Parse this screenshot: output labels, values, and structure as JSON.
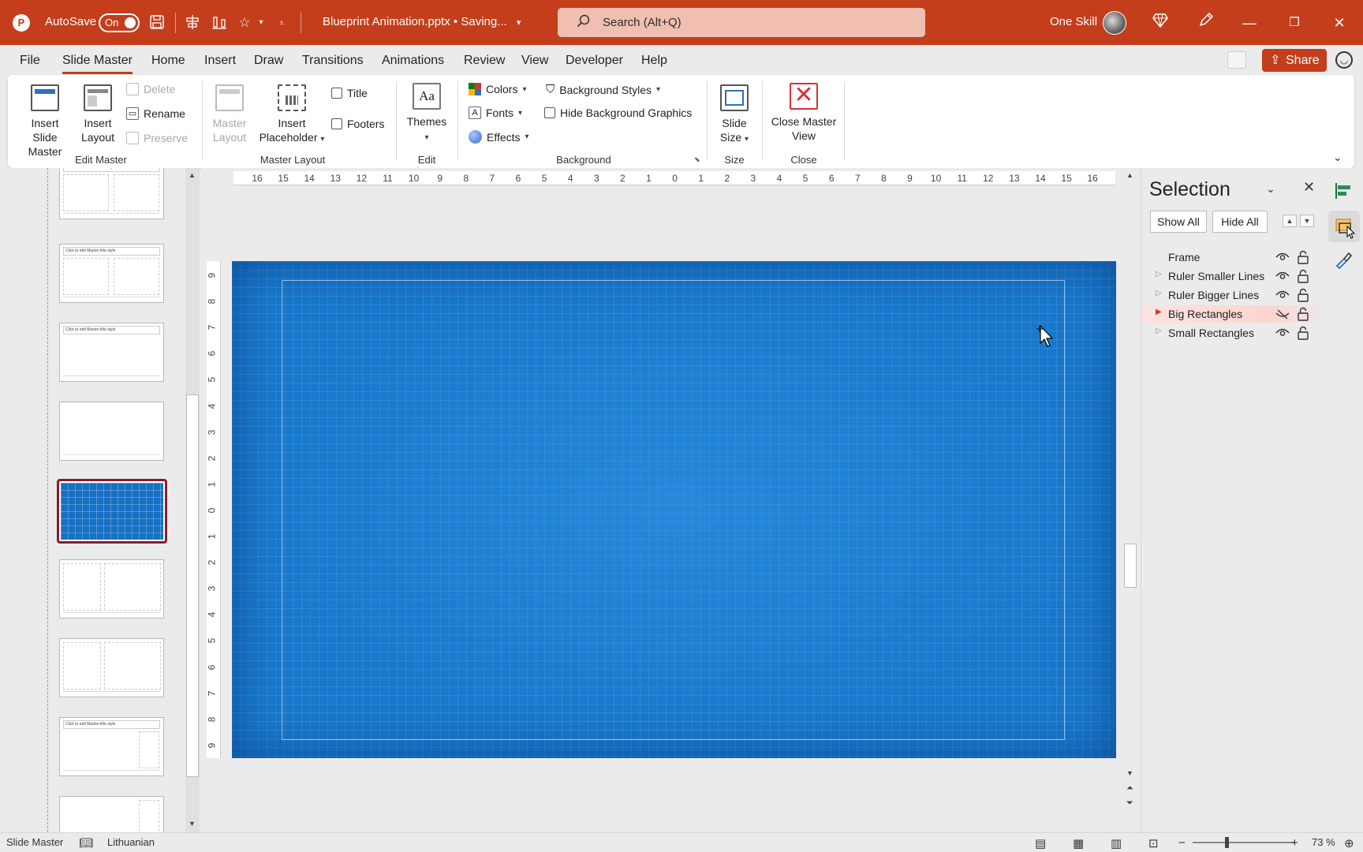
{
  "titlebar": {
    "app_logo": "P",
    "autosave_label": "AutoSave",
    "autosave_state": "On",
    "filename": "Blueprint Animation.pptx • Saving...",
    "search_placeholder": "Search (Alt+Q)",
    "user_name": "One Skill",
    "icons": [
      "powerpoint-logo-icon",
      "save-icon",
      "align-icon",
      "distribute-icon",
      "star-icon",
      "customize-qat-icon",
      "search-icon",
      "premium-diamond-icon",
      "pen-icon",
      "minimize-icon",
      "restore-icon",
      "close-icon"
    ],
    "accent_color": "#c43e1c"
  },
  "menu": {
    "tabs": [
      "File",
      "Slide Master",
      "Home",
      "Insert",
      "Draw",
      "Transitions",
      "Animations",
      "Review",
      "View",
      "Developer",
      "Help"
    ],
    "active_tab": "Slide Master",
    "share_label": "Share"
  },
  "ribbon": {
    "edit_master": {
      "label": "Edit Master",
      "insert_slide_master": "Insert Slide Master",
      "insert_layout": "Insert Layout",
      "delete": "Delete",
      "rename": "Rename",
      "preserve": "Preserve"
    },
    "master_layout": {
      "label": "Master Layout",
      "master_layout_btn": "Master Layout",
      "insert_placeholder": "Insert Placeholder",
      "title_checkbox": "Title",
      "footers_checkbox": "Footers"
    },
    "edit_theme": {
      "label": "Edit Theme",
      "themes": "Themes",
      "themes_icon_text": "Aa"
    },
    "background": {
      "label": "Background",
      "colors": "Colors",
      "fonts": "Fonts",
      "effects": "Effects",
      "background_styles": "Background Styles",
      "hide_background_graphics": "Hide Background Graphics"
    },
    "size": {
      "label": "Size",
      "slide_size": "Slide Size"
    },
    "close": {
      "label": "Close",
      "close_master_view": "Close Master View"
    }
  },
  "thumbnails": {
    "title_placeholder": "Click to edit Master title style",
    "selected_index": 4,
    "selected_color": "#1670c4"
  },
  "rulers": {
    "horizontal": [
      "16",
      "15",
      "14",
      "13",
      "12",
      "11",
      "10",
      "9",
      "8",
      "7",
      "6",
      "5",
      "4",
      "3",
      "2",
      "1",
      "0",
      "1",
      "2",
      "3",
      "4",
      "5",
      "6",
      "7",
      "8",
      "9",
      "10",
      "11",
      "12",
      "13",
      "14",
      "15",
      "16"
    ],
    "vertical": [
      "9",
      "8",
      "7",
      "6",
      "5",
      "4",
      "3",
      "2",
      "1",
      "0",
      "1",
      "2",
      "3",
      "4",
      "5",
      "6",
      "7",
      "8",
      "9"
    ]
  },
  "slide": {
    "background_color": "#1878cc"
  },
  "selection_pane": {
    "title": "Selection",
    "show_all": "Show All",
    "hide_all": "Hide All",
    "items": [
      {
        "name": "Frame",
        "visible": true,
        "expandable": false,
        "selected": false
      },
      {
        "name": "Ruler Smaller Lines",
        "visible": true,
        "expandable": true,
        "selected": false
      },
      {
        "name": "Ruler Bigger Lines",
        "visible": true,
        "expandable": true,
        "selected": false
      },
      {
        "name": "Big Rectangles",
        "visible": false,
        "expandable": true,
        "selected": true
      },
      {
        "name": "Small Rectangles",
        "visible": true,
        "expandable": true,
        "selected": false
      }
    ]
  },
  "statusbar": {
    "view_name": "Slide Master",
    "language": "Lithuanian",
    "zoom": "73 %",
    "zoom_minus": "−",
    "zoom_plus": "+",
    "zoom_level": 0.73
  }
}
